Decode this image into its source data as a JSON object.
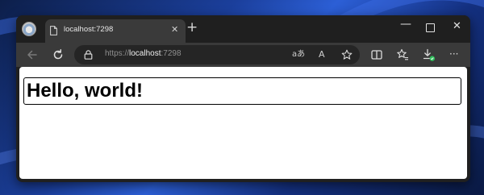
{
  "browser": {
    "tab": {
      "title": "localhost:7298",
      "close_glyph": "✕",
      "icon": "document-icon"
    },
    "new_tab_glyph": "+",
    "window_controls": {
      "minimize_glyph": "—",
      "close_glyph": "✕"
    },
    "address_bar": {
      "url_scheme": "https://",
      "url_host": "localhost",
      "url_port": ":7298",
      "read_aloud_glyph": "aあ",
      "text_size_glyph": "A"
    },
    "toolbar_icons": [
      "back-icon",
      "refresh-icon",
      "lock-icon",
      "favorite-star-icon",
      "split-screen-icon",
      "favorites-icon",
      "downloads-icon",
      "more-icon"
    ],
    "more_glyph": "···"
  },
  "page": {
    "heading": "Hello, world!"
  },
  "colors": {
    "titlebar": "#1f1f1f",
    "toolbar": "#3a3a3a",
    "address_bar": "#252525",
    "page_background": "#ffffff",
    "download_badge": "#2fbf5b"
  }
}
